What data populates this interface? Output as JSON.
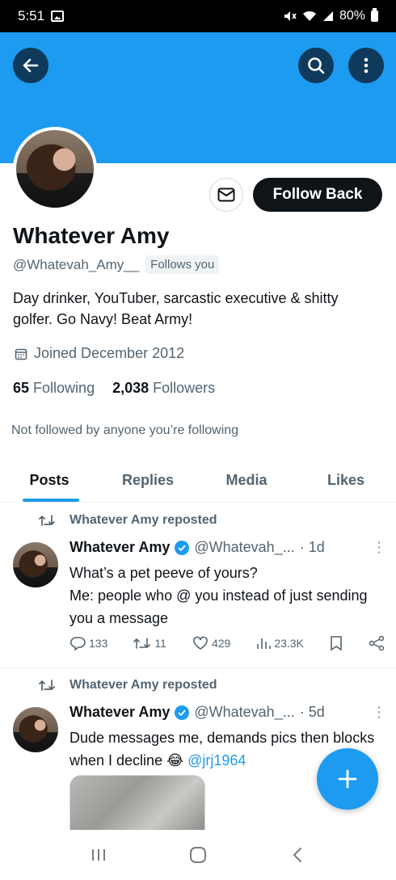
{
  "status_bar": {
    "time": "5:51",
    "battery": "80%"
  },
  "profile": {
    "follow_back_label": "Follow Back",
    "name": "Whatever Amy",
    "handle": "@Whatevah_Amy__",
    "follows_you": "Follows you",
    "bio": "Day drinker, YouTuber, sarcastic executive & shitty golfer. Go Navy! Beat Army!",
    "joined": "Joined December 2012",
    "following_count": "65",
    "following_label": "Following",
    "followers_count": "2,038",
    "followers_label": "Followers",
    "not_followed": "Not followed by anyone you’re following"
  },
  "tabs": [
    {
      "label": "Posts",
      "active": true
    },
    {
      "label": "Replies",
      "active": false
    },
    {
      "label": "Media",
      "active": false
    },
    {
      "label": "Likes",
      "active": false
    }
  ],
  "posts": [
    {
      "repost_label": "Whatever Amy reposted",
      "name": "Whatever Amy",
      "handle": "@Whatevah_...",
      "time": "· 1d",
      "text": "What’s a pet peeve of yours?\nMe: people who @ you instead of just sending you a message",
      "replies": "133",
      "reposts": "11",
      "likes": "429",
      "views": "23.3K"
    },
    {
      "repost_label": "Whatever Amy reposted",
      "name": "Whatever Amy",
      "handle": "@Whatevah_...",
      "time": "· 5d",
      "text": "Dude messages me, demands pics then blocks when I decline 😂",
      "mention": "@jrj1964"
    }
  ],
  "colors": {
    "accent": "#1d9bf0",
    "dark": "#0f1419",
    "muted": "#536471"
  },
  "icons": [
    "back-arrow-icon",
    "search-icon",
    "more-vertical-icon",
    "envelope-icon",
    "calendar-icon",
    "repost-icon",
    "verified-icon",
    "reply-icon",
    "like-icon",
    "views-icon",
    "bookmark-icon",
    "share-icon",
    "plus-icon",
    "recent-apps-icon",
    "home-icon",
    "back-nav-icon"
  ]
}
